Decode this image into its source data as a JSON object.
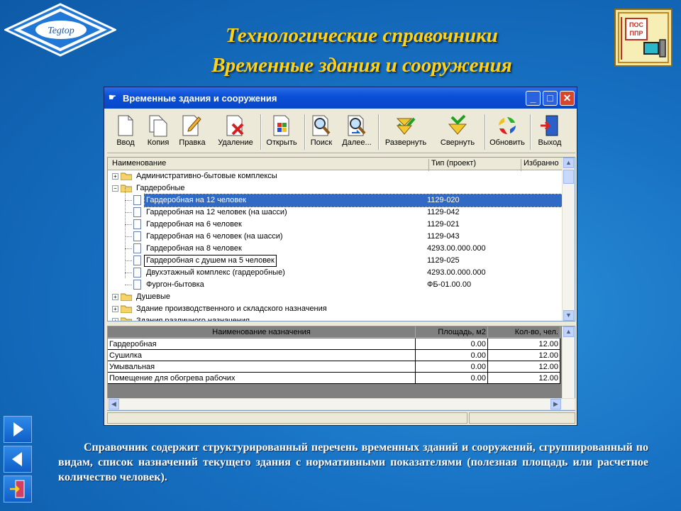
{
  "slide": {
    "title_line1": "Технологические справочники",
    "title_line2": "Временные здания и сооружения",
    "logo_text": "Tegtop",
    "logo_right_text": "ПОС ППР",
    "description": "Справочник содержит структурированный перечень временных зданий и сооружений, сгруппированный по видам, список назначений текущего здания с нормативными показателями (полезная площадь или расчетное количество человек)."
  },
  "window": {
    "title": "Временные здания и сооружения",
    "controls": {
      "minimize": "_",
      "maximize": "□",
      "close": "✕"
    }
  },
  "toolbar": [
    {
      "label": "Ввод",
      "icon": "new-document-icon"
    },
    {
      "label": "Копия",
      "icon": "copy-icon"
    },
    {
      "label": "Правка",
      "icon": "edit-pencil-icon"
    },
    {
      "label": "Удаление",
      "icon": "delete-icon"
    },
    {
      "label": "Открыть",
      "icon": "open-icon"
    },
    {
      "label": "Поиск",
      "icon": "search-icon"
    },
    {
      "label": "Далее...",
      "icon": "search-next-icon"
    },
    {
      "label": "Развернуть",
      "icon": "expand-icon"
    },
    {
      "label": "Свернуть",
      "icon": "collapse-icon"
    },
    {
      "label": "Обновить",
      "icon": "refresh-icon"
    },
    {
      "label": "Выход",
      "icon": "exit-door-icon"
    }
  ],
  "tree": {
    "columns": [
      "Наименование",
      "Тип (проект)",
      "Избранно"
    ],
    "rows": [
      {
        "name": "Административно-бытовые комплексы",
        "type": "",
        "level": 0,
        "kind": "folder",
        "expanded": false
      },
      {
        "name": "Гардеробные",
        "type": "",
        "level": 0,
        "kind": "folder",
        "expanded": true
      },
      {
        "name": "Гардеробная на 12 человек",
        "type": "1129-020",
        "level": 1,
        "kind": "doc",
        "selected": true
      },
      {
        "name": "Гардеробная на 12 человек (на шасси)",
        "type": "1129-042",
        "level": 1,
        "kind": "doc"
      },
      {
        "name": "Гардеробная на 6 человек",
        "type": "1129-021",
        "level": 1,
        "kind": "doc"
      },
      {
        "name": "Гардеробная на 6 человек (на шасси)",
        "type": "1129-043",
        "level": 1,
        "kind": "doc"
      },
      {
        "name": "Гардеробная на 8 человек",
        "type": "4293.00.000.000",
        "level": 1,
        "kind": "doc"
      },
      {
        "name": "Гардеробная с душем на 5 человек",
        "type": "1129-025",
        "level": 1,
        "kind": "doc",
        "focused": true
      },
      {
        "name": "Двухэтажный комплекс (гардеробные)",
        "type": "4293.00.000.000",
        "level": 1,
        "kind": "doc"
      },
      {
        "name": "Фургон-бытовка",
        "type": "ФБ-01.00.00",
        "level": 1,
        "kind": "doc"
      },
      {
        "name": "Душевые",
        "type": "",
        "level": 0,
        "kind": "folder",
        "expanded": false
      },
      {
        "name": "Здание производственного и складского назначения",
        "type": "",
        "level": 0,
        "kind": "folder",
        "expanded": false
      },
      {
        "name": "Здания различного назначения",
        "type": "",
        "level": 0,
        "kind": "folder",
        "expanded": false
      }
    ]
  },
  "grid": {
    "columns": [
      "Наименование назначения",
      "Площадь, м2",
      "Кол-во, чел."
    ],
    "rows": [
      {
        "name": "Гардеробная",
        "area": "0.00",
        "people": "12.00"
      },
      {
        "name": "Сушилка",
        "area": "0.00",
        "people": "12.00"
      },
      {
        "name": "Умывальная",
        "area": "0.00",
        "people": "12.00"
      },
      {
        "name": "Помещение для обогрева рабочих",
        "area": "0.00",
        "people": "12.00"
      }
    ]
  },
  "nav": [
    {
      "icon": "next-arrow-icon"
    },
    {
      "icon": "previous-arrow-icon"
    },
    {
      "icon": "exit-door-icon"
    }
  ]
}
